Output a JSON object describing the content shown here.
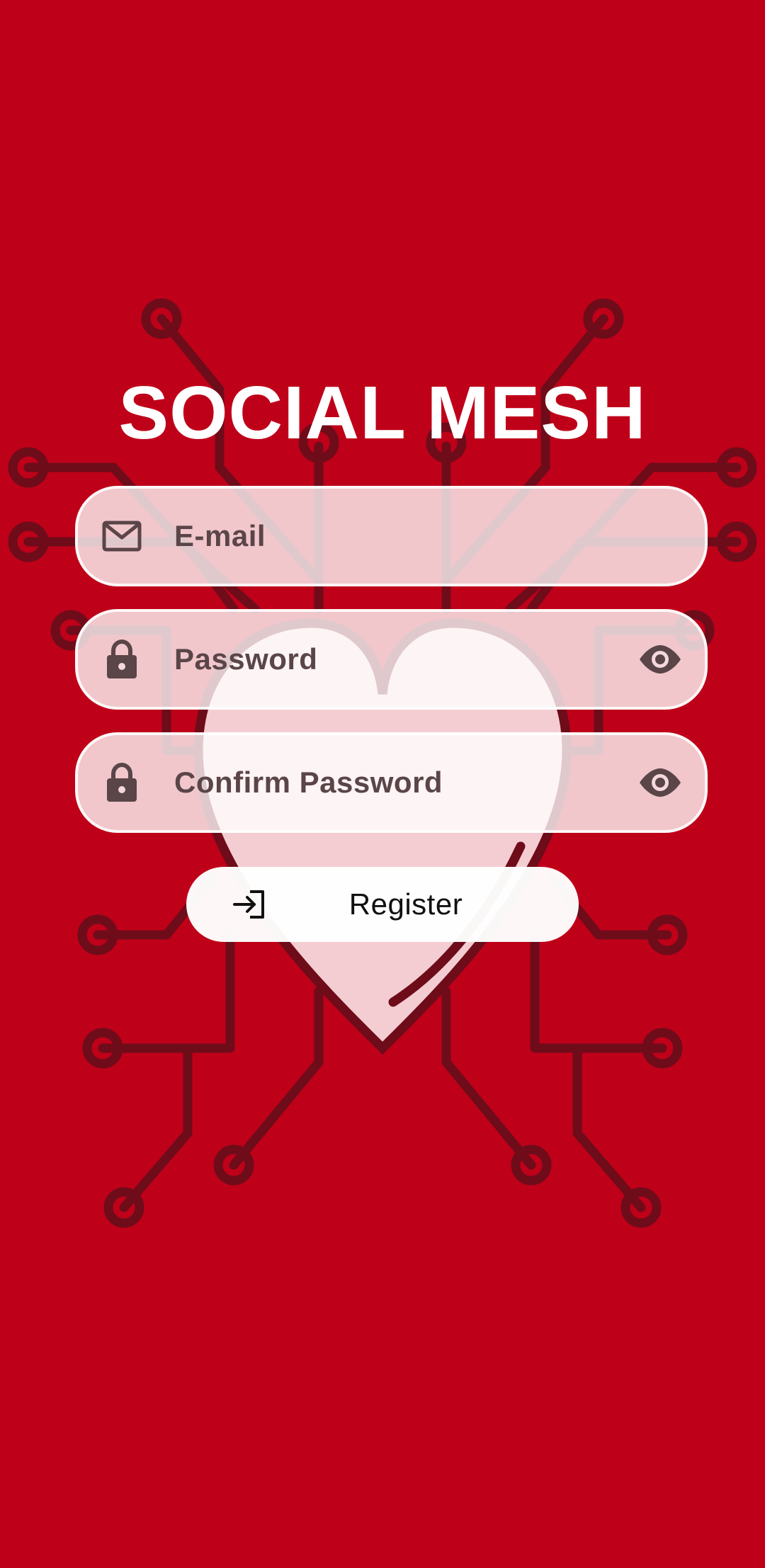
{
  "app": {
    "title": "SOCIAL MESH"
  },
  "form": {
    "email": {
      "placeholder": "E-mail",
      "value": "",
      "icon": "mail-icon"
    },
    "password": {
      "placeholder": "Password",
      "value": "",
      "icon": "lock-icon",
      "toggle_icon": "eye-icon"
    },
    "confirm_password": {
      "placeholder": "Confirm Password",
      "value": "",
      "icon": "lock-icon",
      "toggle_icon": "eye-icon"
    },
    "register": {
      "label": "Register",
      "icon": "login-arrow-icon"
    }
  },
  "colors": {
    "background": "#bf0019",
    "circuit": "#6e0c1a",
    "heart_fill": "#f4cdd2",
    "field_text": "#5a4548"
  }
}
